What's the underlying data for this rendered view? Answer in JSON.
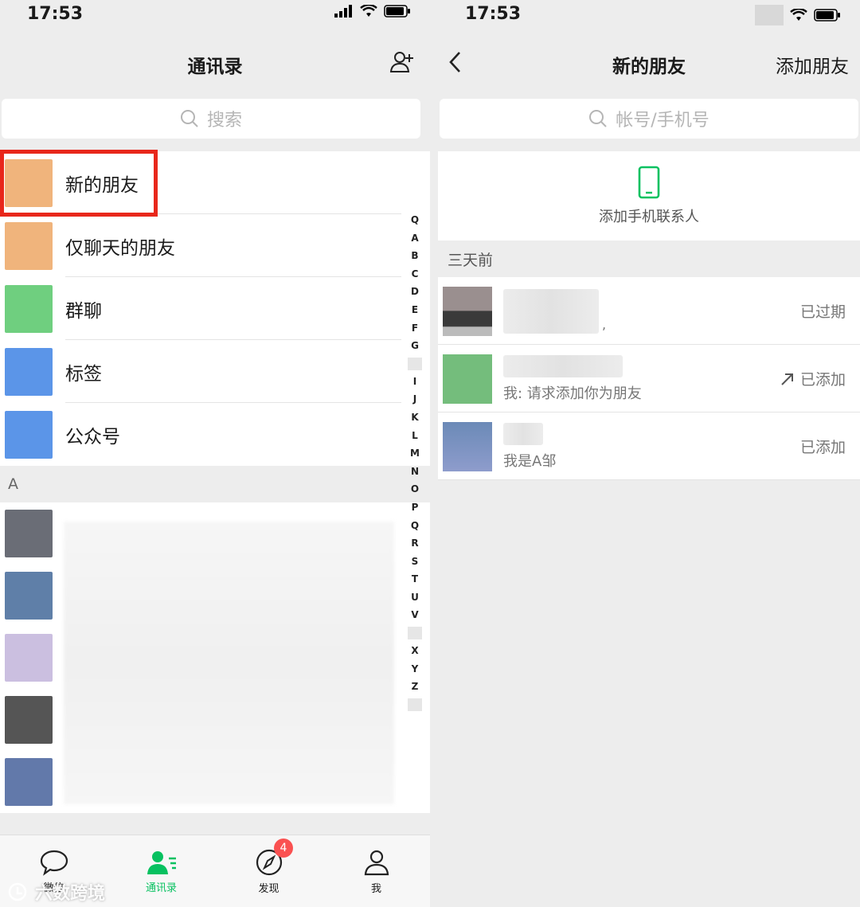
{
  "left": {
    "status_time": "17:53",
    "title": "通讯录",
    "search_placeholder": "搜索",
    "menu_items": [
      {
        "label": "新的朋友",
        "color": "#f0b47c"
      },
      {
        "label": "仅聊天的朋友",
        "color": "#f0b47c"
      },
      {
        "label": "群聊",
        "color": "#6fcf7f"
      },
      {
        "label": "标签",
        "color": "#5b95e8"
      },
      {
        "label": "公众号",
        "color": "#5b95e8"
      }
    ],
    "section_letter": "A",
    "index_letters": [
      "Q",
      "A",
      "B",
      "C",
      "D",
      "E",
      "F",
      "G",
      "",
      "I",
      "J",
      "K",
      "L",
      "M",
      "N",
      "O",
      "P",
      "Q",
      "R",
      "S",
      "T",
      "U",
      "V",
      "",
      "X",
      "Y",
      "Z",
      ""
    ],
    "tabs": [
      {
        "label": "微信",
        "icon": "chat-bubble-icon"
      },
      {
        "label": "通讯录",
        "icon": "contacts-icon"
      },
      {
        "label": "发现",
        "icon": "compass-icon",
        "badge": "4"
      },
      {
        "label": "我",
        "icon": "person-icon"
      }
    ],
    "watermark": "六数跨境"
  },
  "right": {
    "status_time": "17:53",
    "title": "新的朋友",
    "add_friend": "添加朋友",
    "search_placeholder": "帐号/手机号",
    "add_phone_contacts": "添加手机联系人",
    "section_label": "三天前",
    "requests": [
      {
        "message": ",",
        "status": "已过期"
      },
      {
        "message": "我: 请求添加你为朋友",
        "status": "已添加"
      },
      {
        "message": "我是A邹",
        "status": "已添加"
      }
    ]
  },
  "colors": {
    "accent_green": "#07c160",
    "highlight_red": "#e8271b",
    "badge_red": "#fa5151"
  }
}
